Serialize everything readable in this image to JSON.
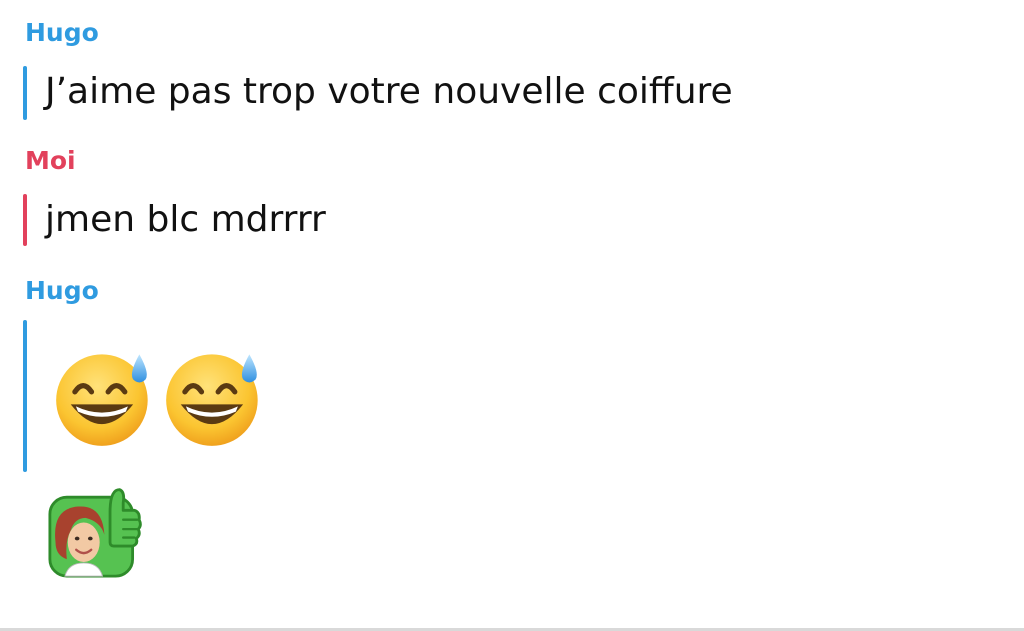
{
  "colors": {
    "hugo": "#2f9be0",
    "moi": "#e2415c",
    "text": "#111111"
  },
  "messages": [
    {
      "sender": "Hugo",
      "text": "J’aime pas trop votre nouvelle coiffure"
    },
    {
      "sender": "Moi",
      "text": "jmen blc mdrrrr"
    },
    {
      "sender": "Hugo",
      "emojis": [
        "grinning-face-with-sweat-icon",
        "grinning-face-with-sweat-icon"
      ]
    }
  ],
  "reaction": {
    "icon": "bitmoji-thumbs-up-icon"
  }
}
